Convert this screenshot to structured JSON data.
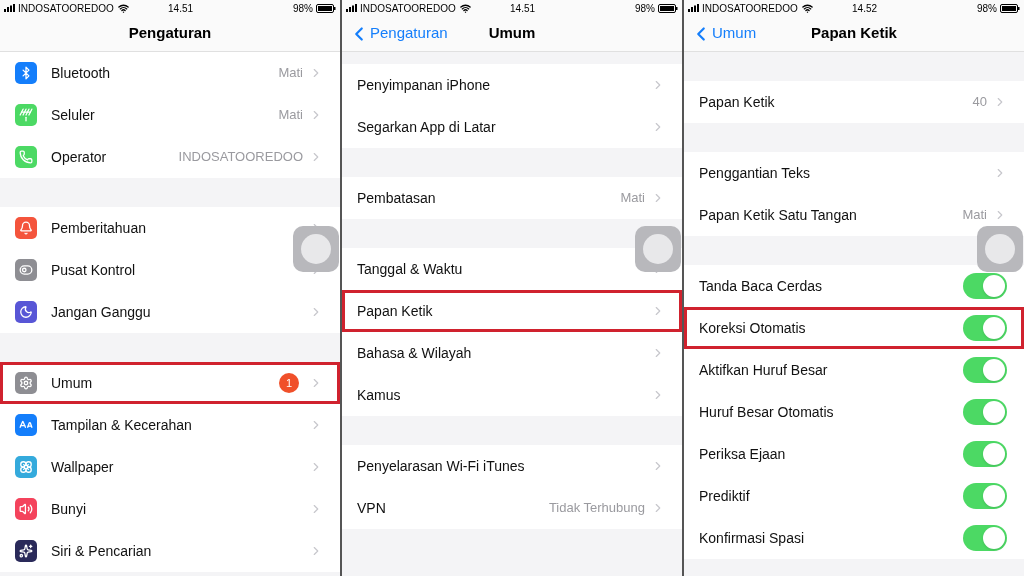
{
  "screens": [
    {
      "status_bar": {
        "carrier": "INDOSATOOREDOO",
        "time": "14.51",
        "battery": "98%"
      },
      "nav": {
        "title": "Pengaturan"
      },
      "sections": [
        {
          "rows": [
            {
              "kind": "link",
              "label": "Bluetooth",
              "value": "Mati",
              "color": "#147efb",
              "highlighted": false
            },
            {
              "kind": "link",
              "label": "Seluler",
              "value": "Mati",
              "color": "#4cd964",
              "highlighted": false
            },
            {
              "kind": "link",
              "label": "Operator",
              "value": "INDOSATOOREDOO",
              "color": "#4cd964",
              "highlighted": false
            }
          ]
        },
        {
          "rows": [
            {
              "kind": "link",
              "label": "Pemberitahuan",
              "color": "#f4543c",
              "highlighted": false
            },
            {
              "kind": "link",
              "label": "Pusat Kontrol",
              "color": "#8e8e93",
              "highlighted": false
            },
            {
              "kind": "link",
              "label": "Jangan Ganggu",
              "color": "#5856d6",
              "highlighted": false
            }
          ]
        },
        {
          "rows": [
            {
              "kind": "link",
              "label": "Umum",
              "badge": "1",
              "color": "#8e8e93",
              "highlighted": true
            },
            {
              "kind": "link",
              "label": "Tampilan & Kecerahan",
              "color": "#147efb",
              "highlighted": false
            },
            {
              "kind": "link",
              "label": "Wallpaper",
              "color": "#34aadc",
              "highlighted": false
            },
            {
              "kind": "link",
              "label": "Bunyi",
              "color": "#f4435c",
              "highlighted": false
            },
            {
              "kind": "link",
              "label": "Siri & Pencarian",
              "color": "#2a2a5a",
              "highlighted": false
            }
          ]
        }
      ]
    },
    {
      "status_bar": {
        "carrier": "INDOSATOOREDOO",
        "time": "14.51",
        "battery": "98%"
      },
      "nav": {
        "back": "Pengaturan",
        "title": "Umum"
      },
      "sections": [
        {
          "rows": [
            {
              "kind": "link",
              "label": "Penyimpanan iPhone",
              "highlighted": false
            },
            {
              "kind": "link",
              "label": "Segarkan App di Latar",
              "highlighted": false
            }
          ]
        },
        {
          "rows": [
            {
              "kind": "link",
              "label": "Pembatasan",
              "value": "Mati",
              "highlighted": false
            }
          ]
        },
        {
          "rows": [
            {
              "kind": "link",
              "label": "Tanggal & Waktu",
              "highlighted": false
            },
            {
              "kind": "link",
              "label": "Papan Ketik",
              "highlighted": true
            },
            {
              "kind": "link",
              "label": "Bahasa & Wilayah",
              "highlighted": false
            },
            {
              "kind": "link",
              "label": "Kamus",
              "highlighted": false
            }
          ]
        },
        {
          "rows": [
            {
              "kind": "link",
              "label": "Penyelarasan Wi-Fi iTunes",
              "highlighted": false
            },
            {
              "kind": "link",
              "label": "VPN",
              "value": "Tidak Terhubung",
              "highlighted": false
            }
          ]
        }
      ]
    },
    {
      "status_bar": {
        "carrier": "INDOSATOOREDOO",
        "time": "14.52",
        "battery": "98%"
      },
      "nav": {
        "back": "Umum",
        "title": "Papan Ketik"
      },
      "sections": [
        {
          "rows": [
            {
              "kind": "link",
              "label": "Papan Ketik",
              "value": "40",
              "highlighted": false
            }
          ]
        },
        {
          "rows": [
            {
              "kind": "link",
              "label": "Penggantian Teks",
              "highlighted": false
            },
            {
              "kind": "link",
              "label": "Papan Ketik Satu Tangan",
              "value": "Mati",
              "highlighted": false
            }
          ]
        },
        {
          "rows": [
            {
              "kind": "toggle",
              "label": "Tanda Baca Cerdas",
              "on": true,
              "highlighted": false
            },
            {
              "kind": "toggle",
              "label": "Koreksi Otomatis",
              "on": true,
              "highlighted": true
            },
            {
              "kind": "toggle",
              "label": "Aktifkan Huruf Besar",
              "on": true,
              "highlighted": false
            },
            {
              "kind": "toggle",
              "label": "Huruf Besar Otomatis",
              "on": true,
              "highlighted": false
            },
            {
              "kind": "toggle",
              "label": "Periksa Ejaan",
              "on": true,
              "highlighted": false
            },
            {
              "kind": "toggle",
              "label": "Prediktif",
              "on": true,
              "highlighted": false
            },
            {
              "kind": "toggle",
              "label": "Konfirmasi Spasi",
              "on": true,
              "highlighted": false
            }
          ]
        }
      ]
    }
  ]
}
